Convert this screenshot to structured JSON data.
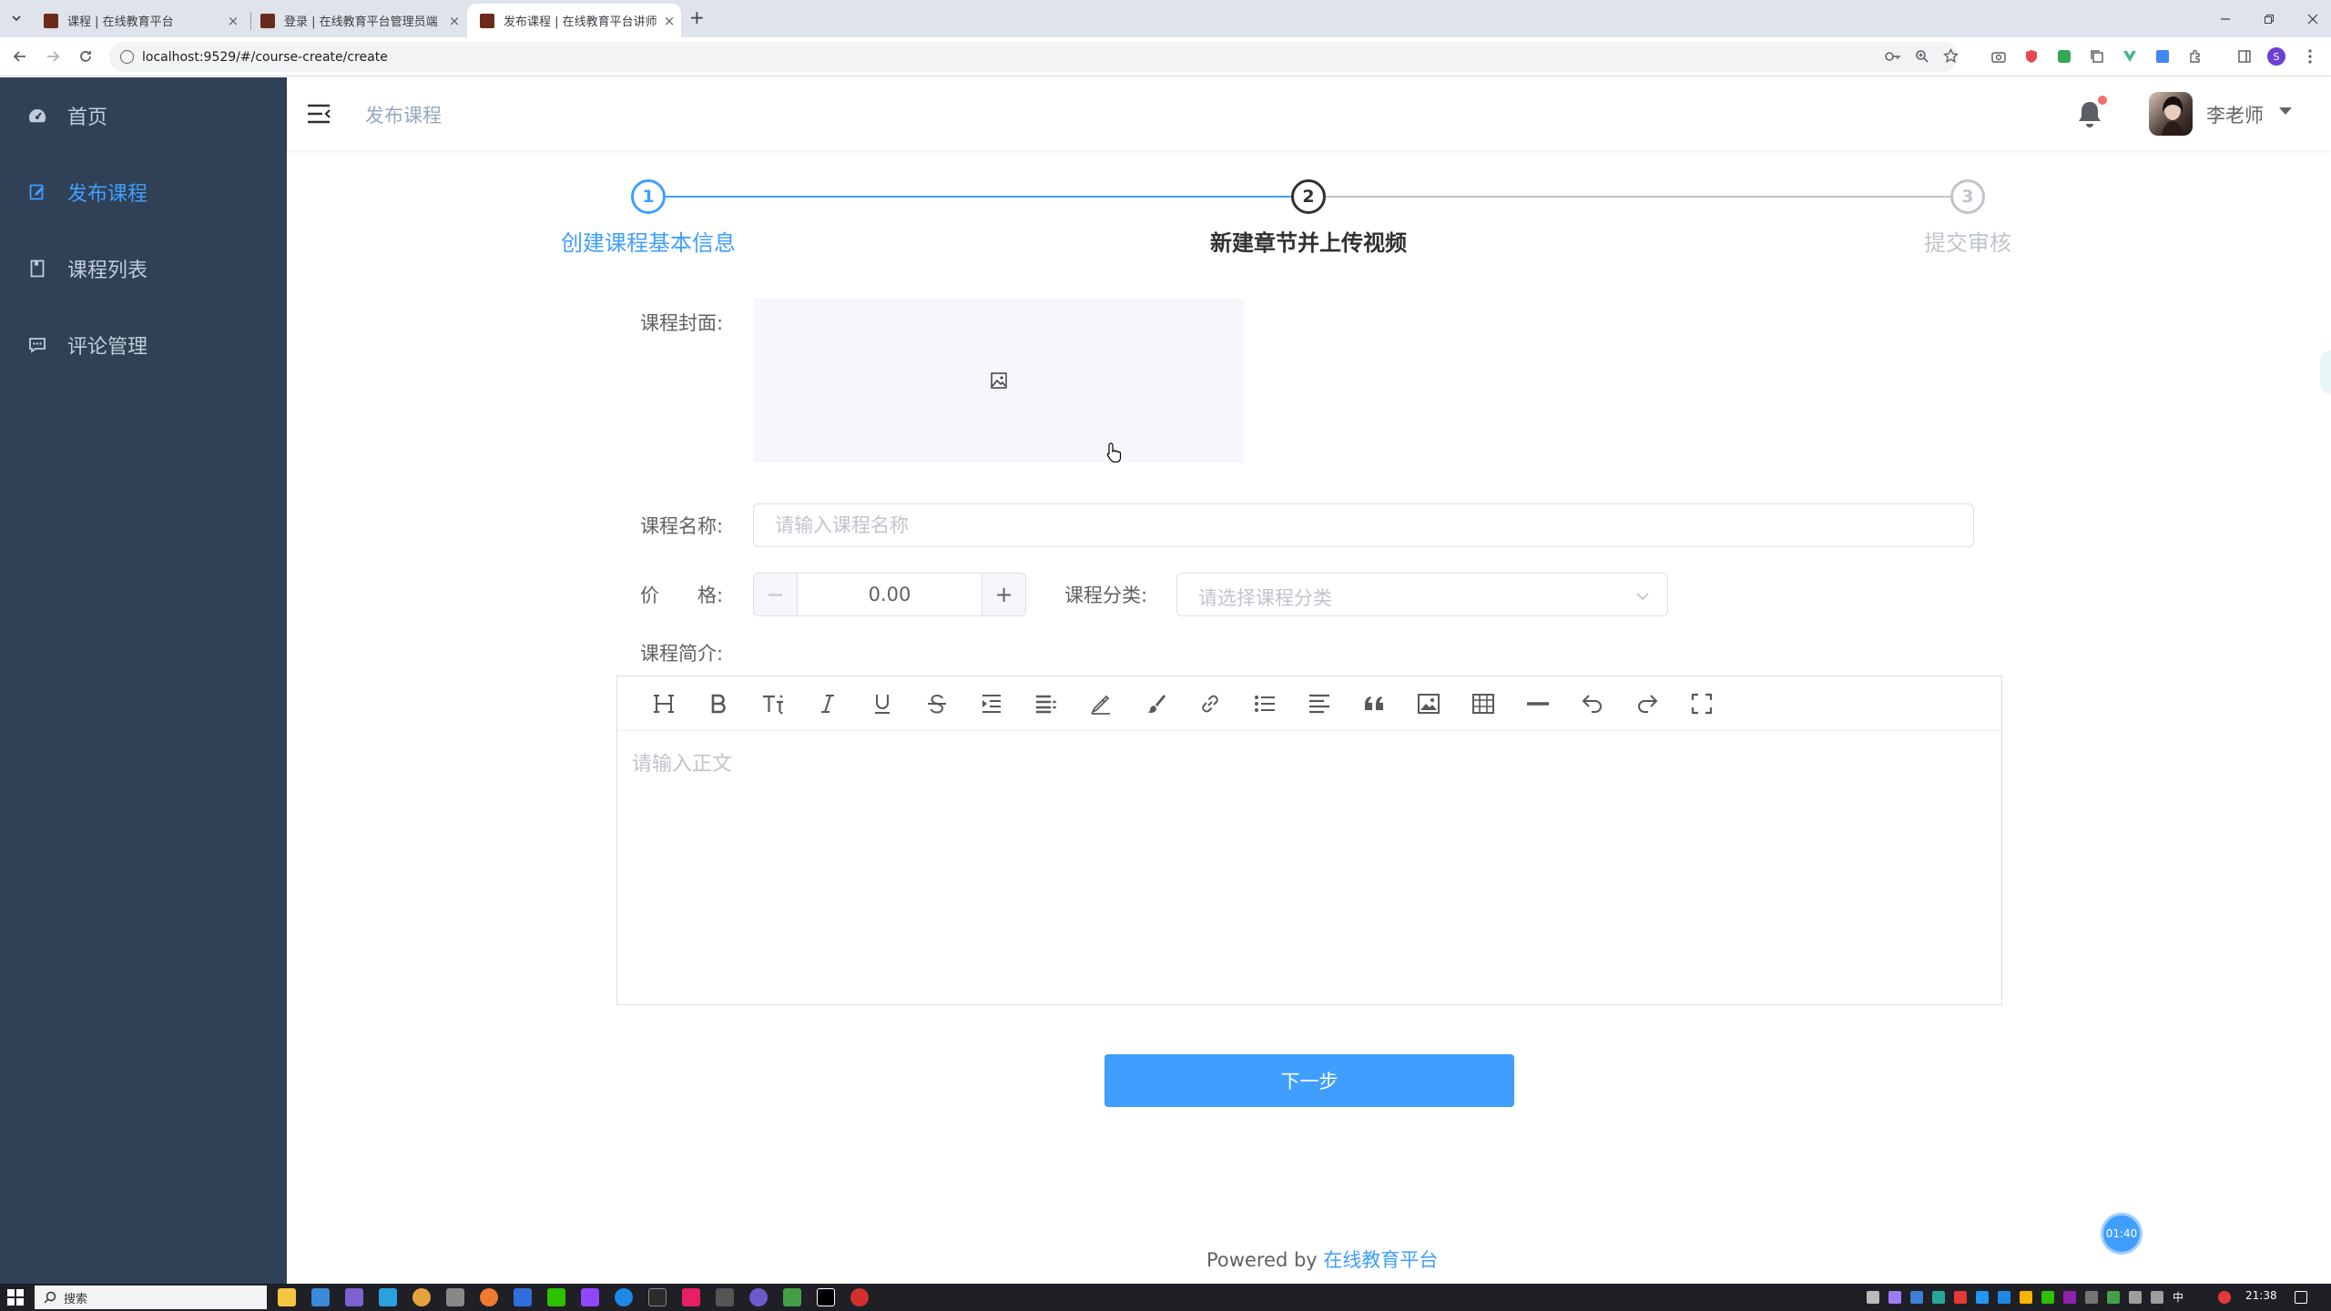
{
  "browser": {
    "tabs": [
      {
        "title": "课程 | 在线教育平台",
        "active": false
      },
      {
        "title": "登录 | 在线教育平台管理员端",
        "active": false
      },
      {
        "title": "发布课程 | 在线教育平台讲师端",
        "active": true
      }
    ],
    "new_tab_label": "+",
    "url": "localhost:9529/#/course-create/create",
    "profile_initial": "S"
  },
  "sidebar": {
    "items": [
      {
        "label": "首页",
        "icon": "dashboard-icon",
        "active": false
      },
      {
        "label": "发布课程",
        "icon": "edit-icon",
        "active": true
      },
      {
        "label": "课程列表",
        "icon": "list-icon",
        "active": false
      },
      {
        "label": "评论管理",
        "icon": "comment-icon",
        "active": false
      }
    ]
  },
  "header": {
    "breadcrumb": "发布课程",
    "username": "李老师"
  },
  "steps": [
    {
      "number": "1",
      "title": "创建课程基本信息",
      "status": "finished"
    },
    {
      "number": "2",
      "title": "新建章节并上传视频",
      "status": "process"
    },
    {
      "number": "3",
      "title": "提交审核",
      "status": "wait"
    }
  ],
  "form": {
    "cover_label": "课程封面:",
    "name_label": "课程名称:",
    "name_placeholder": "请输入课程名称",
    "price_label": "价　　格:",
    "price_value": "0.00",
    "price_minus": "−",
    "price_plus": "+",
    "category_label": "课程分类:",
    "category_placeholder": "请选择课程分类",
    "intro_label": "课程简介:",
    "editor_placeholder": "请输入正文",
    "editor_tools": [
      "heading-icon",
      "bold-icon",
      "font-size-icon",
      "italic-icon",
      "underline-icon",
      "strikethrough-icon",
      "indent-icon",
      "line-height-icon",
      "font-color-icon",
      "background-color-icon",
      "link-icon",
      "bulleted-list-icon",
      "align-icon",
      "quote-icon",
      "image-icon",
      "table-icon",
      "divider-icon",
      "undo-icon",
      "redo-icon",
      "fullscreen-icon"
    ],
    "next_button": "下一步"
  },
  "footer": {
    "prefix": "Powered by ",
    "link": "在线教育平台"
  },
  "timer_badge": "01:40",
  "taskbar": {
    "search_placeholder": "搜索",
    "clock": "21:38",
    "ime": "中"
  },
  "colors": {
    "primary": "#409eff",
    "sidebar_bg": "#304156",
    "sidebar_text": "#bfcbd9",
    "step_process": "#303133",
    "step_wait": "#c0c4cc"
  }
}
